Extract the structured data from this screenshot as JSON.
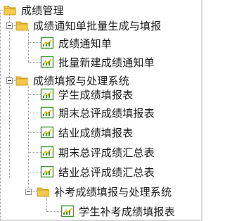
{
  "tree": {
    "root": {
      "label": "成绩管理",
      "icon": "folder-icon",
      "children": [
        {
          "label": "成绩通知单批量生成与填报",
          "icon": "folder-icon",
          "children": [
            {
              "label": "成绩通知单",
              "icon": "report-icon"
            },
            {
              "label": "批量新建成绩通知单",
              "icon": "report-icon"
            }
          ]
        },
        {
          "label": "成绩填报与处理系统",
          "icon": "folder-icon",
          "children": [
            {
              "label": "学生成绩填报表",
              "icon": "report-icon"
            },
            {
              "label": "期末总评成绩填报表",
              "icon": "report-icon"
            },
            {
              "label": "结业成绩填报表",
              "icon": "report-icon"
            },
            {
              "label": "期末总评成绩汇总表",
              "icon": "report-icon"
            },
            {
              "label": "结业总评成绩汇总表",
              "icon": "report-icon"
            },
            {
              "label": "补考成绩填报与处理系统",
              "icon": "folder-icon",
              "children": [
                {
                  "label": "学生补考成绩填报表",
                  "icon": "report-icon"
                }
              ]
            }
          ]
        }
      ]
    }
  },
  "colors": {
    "folder": "#f2c94c",
    "folder_dark": "#c99a1c",
    "report_bg": "#ffffff",
    "report_green": "#3f9a36",
    "report_yellow": "#e8c21e",
    "lines": "#9a9a9a"
  }
}
